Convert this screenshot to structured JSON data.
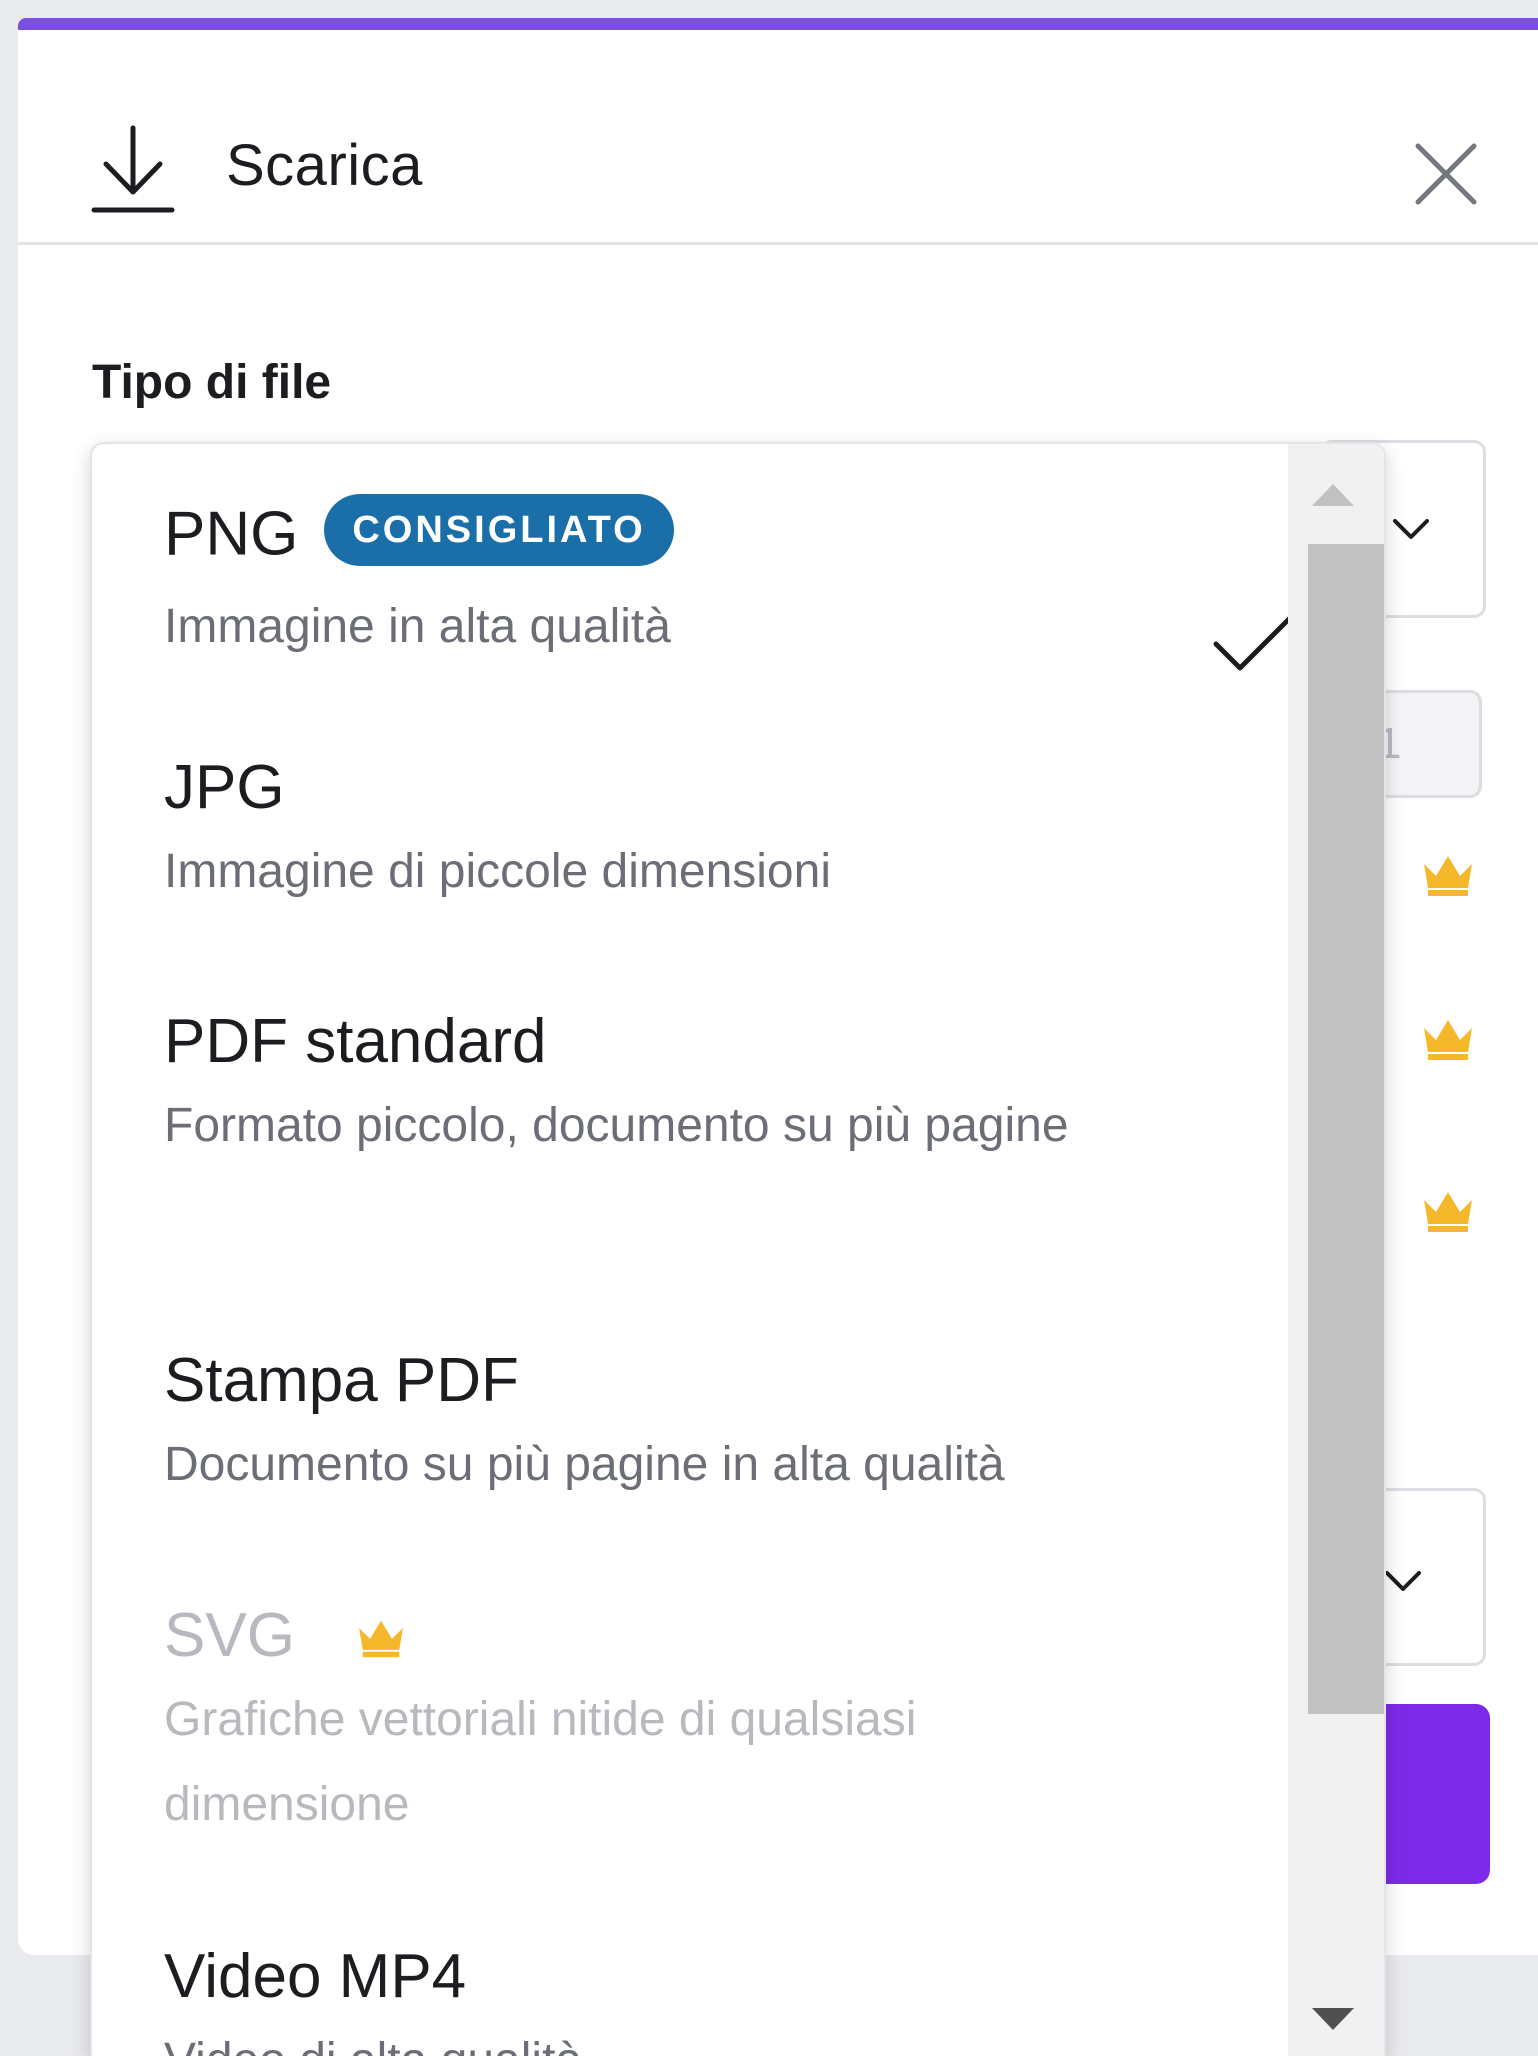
{
  "header": {
    "title": "Scarica",
    "download_icon": "download-icon",
    "close_icon": "close-icon"
  },
  "file_type": {
    "label": "Tipo di file"
  },
  "background": {
    "page_input_value": "1",
    "crown_icon": "crown-icon",
    "accent_color": "#7d2ae8",
    "crown_color": "#f6b82b"
  },
  "dropdown": {
    "selected": "PNG",
    "options": [
      {
        "title": "PNG",
        "badge": "CONSIGLIATO",
        "description": "Immagine in alta qualità",
        "selected": true,
        "premium": false,
        "disabled": false
      },
      {
        "title": "JPG",
        "description": "Immagine di piccole dimensioni",
        "selected": false,
        "premium": false,
        "disabled": false
      },
      {
        "title": "PDF standard",
        "description": "Formato piccolo, documento su più pagine",
        "selected": false,
        "premium": false,
        "disabled": false
      },
      {
        "title": "Stampa PDF",
        "description": "Documento su più pagine in alta qualità",
        "selected": false,
        "premium": false,
        "disabled": false
      },
      {
        "title": "SVG",
        "description": "Grafiche vettoriali nitide di qualsiasi dimensione",
        "selected": false,
        "premium": true,
        "disabled": true
      },
      {
        "title": "Video MP4",
        "description": "Video di alta qualità",
        "selected": false,
        "premium": false,
        "disabled": false
      }
    ],
    "badge_color": "#1b6fa8"
  }
}
